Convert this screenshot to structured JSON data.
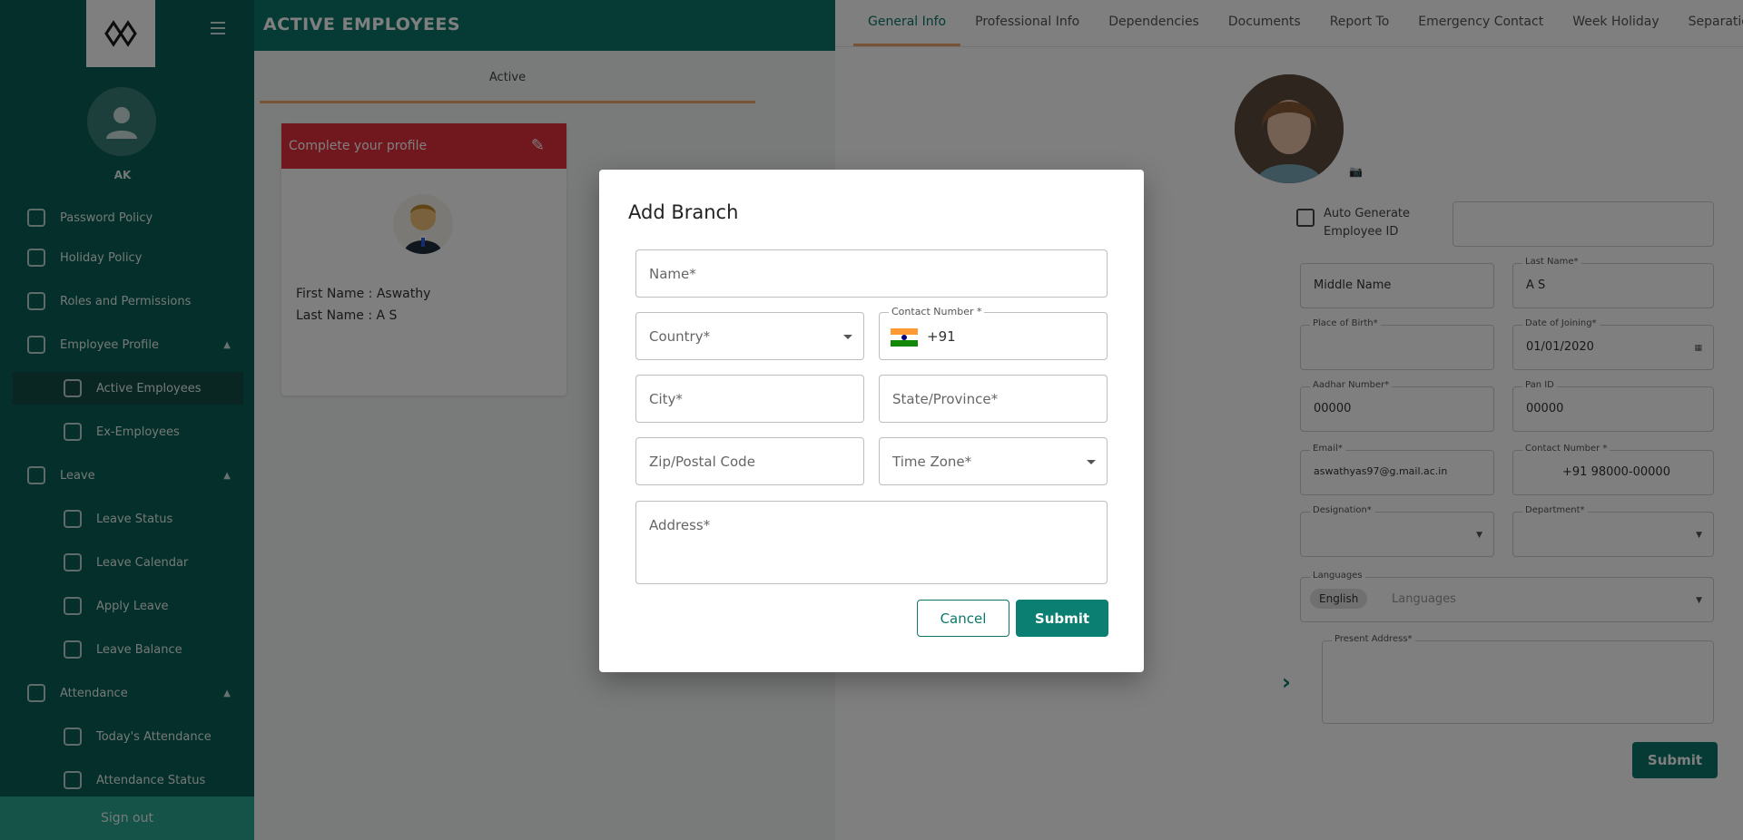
{
  "sidebar": {
    "initials": "AK",
    "items": [
      {
        "label": "Password Policy",
        "icon": "lock-icon"
      },
      {
        "label": "Holiday Policy",
        "icon": "calendar-icon"
      },
      {
        "label": "Roles and Permissions",
        "icon": "key-icon"
      },
      {
        "label": "Employee Profile",
        "icon": "people-icon"
      },
      {
        "label": "Active Employees",
        "icon": "person-icon"
      },
      {
        "label": "Ex-Employees",
        "icon": "person-off-icon"
      },
      {
        "label": "Leave",
        "icon": "leaf-icon"
      },
      {
        "label": "Leave Status",
        "icon": "document-icon"
      },
      {
        "label": "Leave Calendar",
        "icon": "calendar-icon"
      },
      {
        "label": "Apply Leave",
        "icon": "send-icon"
      },
      {
        "label": "Leave Balance",
        "icon": "pie-icon"
      },
      {
        "label": "Attendance",
        "icon": "clipboard-icon"
      },
      {
        "label": "Today's Attendance",
        "icon": "clock-icon"
      },
      {
        "label": "Attendance Status",
        "icon": "clock-icon"
      }
    ],
    "signout": "Sign out"
  },
  "topbar": {
    "title": "ACTIVE EMPLOYEES"
  },
  "middle": {
    "tab": "Active",
    "card_header": "Complete your profile",
    "first_name": "First Name : Aswathy",
    "last_name": "Last Name : A S"
  },
  "right": {
    "tabs": [
      "General Info",
      "Professional Info",
      "Dependencies",
      "Documents",
      "Report To",
      "Emergency Contact",
      "Week Holiday",
      "Separation"
    ],
    "auto_generate": "Auto Generate Employee ID",
    "fields": {
      "middle_name": "Middle Name",
      "last_name_label": "Last Name*",
      "last_name_value": "A S",
      "place_birth_label": "Place of Birth*",
      "date_joining_label": "Date of Joining*",
      "date_joining_value": "01/01/2020",
      "aadhar_label": "Aadhar Number*",
      "aadhar_value": "00000",
      "pan_label": "Pan ID",
      "pan_value": "00000",
      "email_label": "Email*",
      "email_value": "aswathyas97@g.mail.ac.in",
      "contact_label": "Contact Number *",
      "contact_value": "+91 98000-00000",
      "designation_label": "Designation*",
      "department_label": "Department*",
      "languages_label": "Languages",
      "language_chip": "English",
      "languages_placeholder": "Languages",
      "present_address_label": "Present Address*"
    },
    "submit": "Submit"
  },
  "modal": {
    "title": "Add Branch",
    "name_placeholder": "Name*",
    "country_placeholder": "Country*",
    "contact_label": "Contact Number *",
    "dial_code": "+91",
    "city_placeholder": "City*",
    "state_placeholder": "State/Province*",
    "zip_placeholder": "Zip/Postal Code",
    "timezone_placeholder": "Time Zone*",
    "address_placeholder": "Address*",
    "cancel": "Cancel",
    "submit": "Submit"
  },
  "colors": {
    "primary": "#0b7769",
    "accent": "#f0a86b",
    "alert": "#e1303a",
    "flag_saffron": "#ff9933",
    "flag_white": "#ffffff",
    "flag_green": "#138808"
  }
}
